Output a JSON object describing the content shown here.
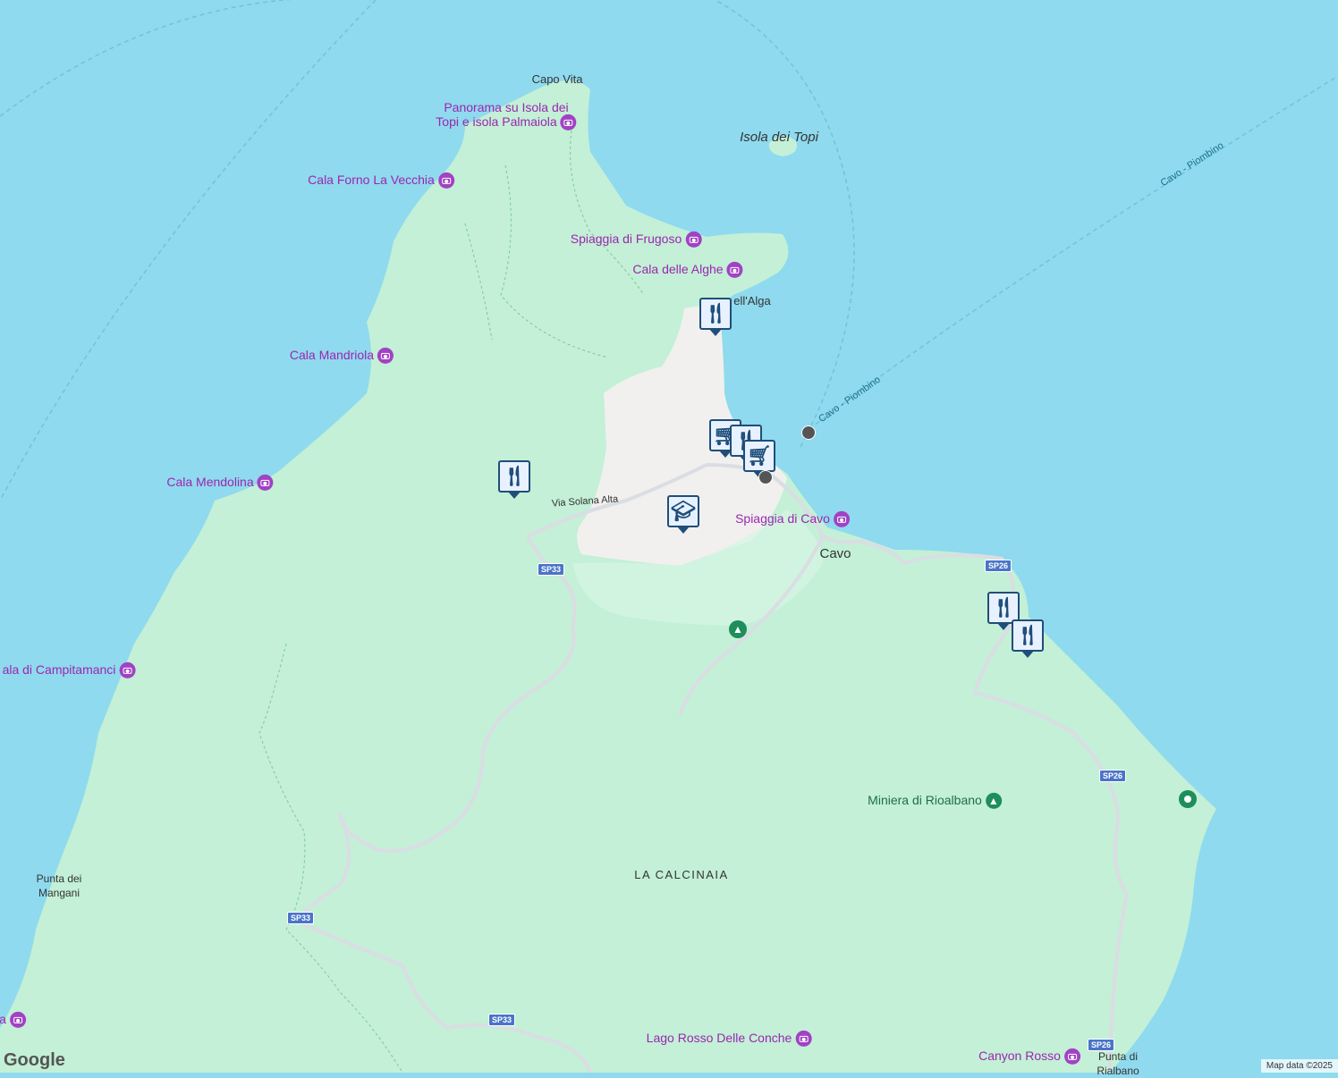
{
  "colors": {
    "sea": "#8fdaee",
    "land": "#c3f0d6",
    "town": "#f1f0ef",
    "road": "#dadde3",
    "poi": "#a142c4",
    "marker": "#1f4e79"
  },
  "sea_labels": [
    {
      "id": "isola-dei-topi",
      "text": "Isola dei Topi"
    }
  ],
  "place_labels": [
    {
      "id": "cavo",
      "text": "Cavo"
    },
    {
      "id": "capo-vita",
      "text": "Capo Vita"
    },
    {
      "id": "punta-dei-mangani",
      "text": "Punta dei\nMangani"
    },
    {
      "id": "punta-di-rialbano",
      "text": "Punta di\nRialbano"
    }
  ],
  "area_labels": [
    {
      "id": "la-calcinaia",
      "text": "LA CALCINAIA"
    }
  ],
  "poi_labels": [
    {
      "id": "panorama",
      "text": "Panorama su Isola dei\nTopi e isola Palmaiola",
      "icon": "camera-icon"
    },
    {
      "id": "cala-forno",
      "text": "Cala Forno La Vecchia",
      "icon": "camera-icon"
    },
    {
      "id": "spiaggia-frugoso",
      "text": "Spiaggia di Frugoso",
      "icon": "camera-icon"
    },
    {
      "id": "cala-alghe",
      "text": "Cala delle Alghe",
      "icon": "camera-icon"
    },
    {
      "id": "cala-mandriola",
      "text": "Cala Mandriola",
      "icon": "camera-icon"
    },
    {
      "id": "cala-mendolina",
      "text": "Cala Mendolina",
      "icon": "camera-icon"
    },
    {
      "id": "spiaggia-cavo",
      "text": "Spiaggia di Cavo",
      "icon": "camera-icon"
    },
    {
      "id": "campitamanci",
      "text": "ala di Campitamanci",
      "icon": "camera-icon"
    },
    {
      "id": "lago-rosso",
      "text": "Lago Rosso Delle Conche",
      "icon": "camera-icon"
    },
    {
      "id": "canyon-rosso",
      "text": "Canyon Rosso",
      "icon": "camera-icon"
    },
    {
      "id": "edge-a",
      "text": "a",
      "icon": "camera-icon"
    }
  ],
  "green_labels": [
    {
      "id": "miniera",
      "text": "Miniera di Rioalbano",
      "icon": "tree-icon"
    }
  ],
  "road_labels": [
    {
      "id": "via-solana",
      "text": "Via Solana Alta"
    },
    {
      "id": "alga",
      "text": "ell'Alga"
    }
  ],
  "ferry_labels": [
    {
      "id": "ferry-1",
      "text": "Cavo - Piombino"
    },
    {
      "id": "ferry-2",
      "text": "Cavo - Piombino"
    }
  ],
  "road_shields": [
    {
      "id": "sp33-a",
      "text": "SP33"
    },
    {
      "id": "sp33-b",
      "text": "SP33"
    },
    {
      "id": "sp33-c",
      "text": "SP33"
    },
    {
      "id": "sp26-a",
      "text": "SP26"
    },
    {
      "id": "sp26-b",
      "text": "SP26"
    },
    {
      "id": "sp26-c",
      "text": "SP26"
    }
  ],
  "markers": [
    {
      "id": "restaurant-1",
      "type": "restaurant-icon"
    },
    {
      "id": "restaurant-2",
      "type": "restaurant-icon"
    },
    {
      "id": "restaurant-3",
      "type": "restaurant-icon"
    },
    {
      "id": "restaurant-4",
      "type": "restaurant-icon"
    },
    {
      "id": "school-1",
      "type": "graduation-cap-icon"
    },
    {
      "id": "shop-1",
      "type": "shopping-cart-icon"
    },
    {
      "id": "restaurant-5",
      "type": "restaurant-icon"
    },
    {
      "id": "shop-2",
      "type": "shopping-cart-icon"
    }
  ],
  "logo": "Google",
  "attribution": "Map data ©2025"
}
